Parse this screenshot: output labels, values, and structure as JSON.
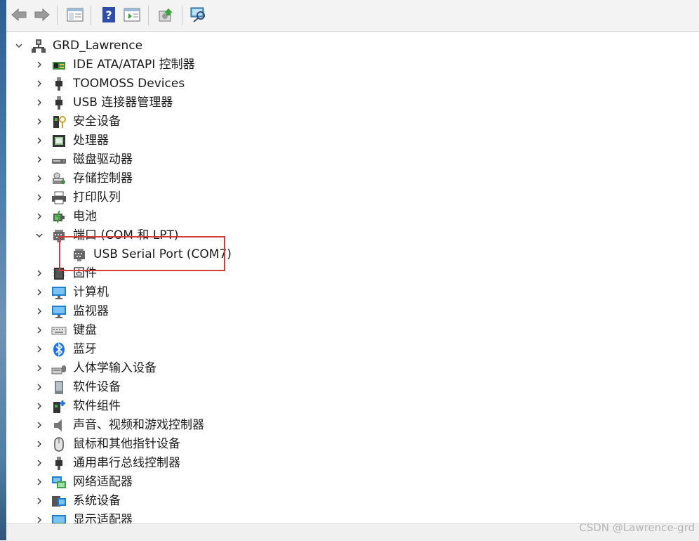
{
  "toolbar": {
    "buttons": [
      "back",
      "forward",
      "show-hide-console-tree",
      "help",
      "action-pane",
      "update-driver",
      "scan-hardware"
    ]
  },
  "tree": {
    "root": {
      "label": "GRD_Lawrence",
      "icon": "computer-network-icon",
      "expanded": true
    },
    "items": [
      {
        "label": "IDE ATA/ATAPI 控制器",
        "icon": "ide-controller-icon",
        "expanded": false
      },
      {
        "label": "TOOMOSS Devices",
        "icon": "usb-plug-icon",
        "expanded": false
      },
      {
        "label": "USB 连接器管理器",
        "icon": "usb-plug-icon",
        "expanded": false
      },
      {
        "label": "安全设备",
        "icon": "security-key-icon",
        "expanded": false
      },
      {
        "label": "处理器",
        "icon": "processor-icon",
        "expanded": false
      },
      {
        "label": "磁盘驱动器",
        "icon": "disk-drive-icon",
        "expanded": false
      },
      {
        "label": "存储控制器",
        "icon": "storage-controller-icon",
        "expanded": false
      },
      {
        "label": "打印队列",
        "icon": "printer-icon",
        "expanded": false
      },
      {
        "label": "电池",
        "icon": "battery-icon",
        "expanded": false
      },
      {
        "label": "端口 (COM 和 LPT)",
        "icon": "port-icon",
        "expanded": true,
        "children": [
          {
            "label": "USB Serial Port (COM7)",
            "icon": "port-icon"
          }
        ]
      },
      {
        "label": "固件",
        "icon": "firmware-icon",
        "expanded": false
      },
      {
        "label": "计算机",
        "icon": "monitor-icon",
        "expanded": false
      },
      {
        "label": "监视器",
        "icon": "monitor-icon",
        "expanded": false
      },
      {
        "label": "键盘",
        "icon": "keyboard-icon",
        "expanded": false
      },
      {
        "label": "蓝牙",
        "icon": "bluetooth-icon",
        "expanded": false
      },
      {
        "label": "人体学输入设备",
        "icon": "hid-icon",
        "expanded": false
      },
      {
        "label": "软件设备",
        "icon": "software-device-icon",
        "expanded": false
      },
      {
        "label": "软件组件",
        "icon": "software-component-icon",
        "expanded": false
      },
      {
        "label": "声音、视频和游戏控制器",
        "icon": "speaker-icon",
        "expanded": false
      },
      {
        "label": "鼠标和其他指针设备",
        "icon": "mouse-icon",
        "expanded": false
      },
      {
        "label": "通用串行总线控制器",
        "icon": "usb-plug-icon",
        "expanded": false
      },
      {
        "label": "网络适配器",
        "icon": "network-adapter-icon",
        "expanded": false
      },
      {
        "label": "系统设备",
        "icon": "system-device-icon",
        "expanded": false
      },
      {
        "label": "显示适配器",
        "icon": "display-adapter-icon",
        "expanded": false
      }
    ]
  },
  "watermark": "CSDN @Lawrence-grd",
  "colors": {
    "highlight": "#d33b3b",
    "toolbar_bg": "#f3f3f3"
  }
}
